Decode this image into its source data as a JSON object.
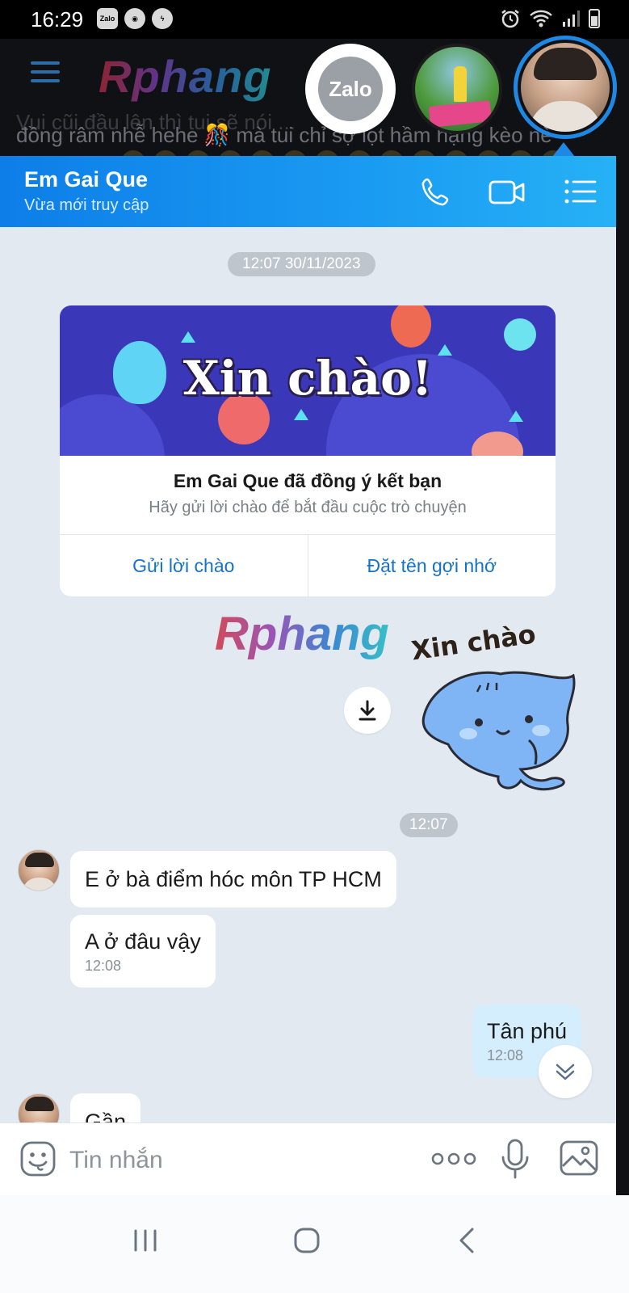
{
  "status_bar": {
    "time": "16:29",
    "icons": [
      "zalo-icon",
      "media-icon",
      "messenger-icon"
    ],
    "right_icons": [
      "alarm-icon",
      "wifi-icon",
      "signal-icon",
      "battery-icon"
    ]
  },
  "background": {
    "logo_text": "Rphang",
    "text_line_1": "Vui cũi đầu lên thì tui sẽ nói ...",
    "text_line_2": "đồng râm nhễ hehe 🎊 mà tui chỉ sợ lọt hầm hạng kèo nè"
  },
  "chat_heads": {
    "zalo_label": "Zalo"
  },
  "header": {
    "contact_name": "Em Gai Que",
    "status": "Vừa mới truy cập"
  },
  "chat": {
    "date_chip": "12:07 30/11/2023",
    "greeting_card": {
      "banner_title": "Xin chào!",
      "headline": "Em Gai Que đã đồng ý kết bạn",
      "subtext": "Hãy gửi lời chào để bắt đầu cuộc trò chuyện",
      "action_send": "Gửi lời chào",
      "action_nickname": "Đặt tên gợi nhớ"
    },
    "watermark": "Rphang",
    "sticker_text": "Xin chào",
    "time_chip": "12:07",
    "messages": [
      {
        "from": "them",
        "text": "E ở bà điểm hóc môn TP HCM"
      },
      {
        "from": "them",
        "text": "A ở đâu vậy",
        "time": "12:08"
      },
      {
        "from": "me",
        "text": "Tân phú",
        "time": "12:08"
      },
      {
        "from": "them",
        "text": "Gần"
      }
    ]
  },
  "input": {
    "placeholder": "Tin nhắn"
  },
  "colors": {
    "header_start": "#0d7ee8",
    "header_end": "#26b1f5",
    "chat_bg": "#e2e9f1",
    "accent_blue": "#1672c9",
    "my_bubble": "#d5eefd"
  }
}
